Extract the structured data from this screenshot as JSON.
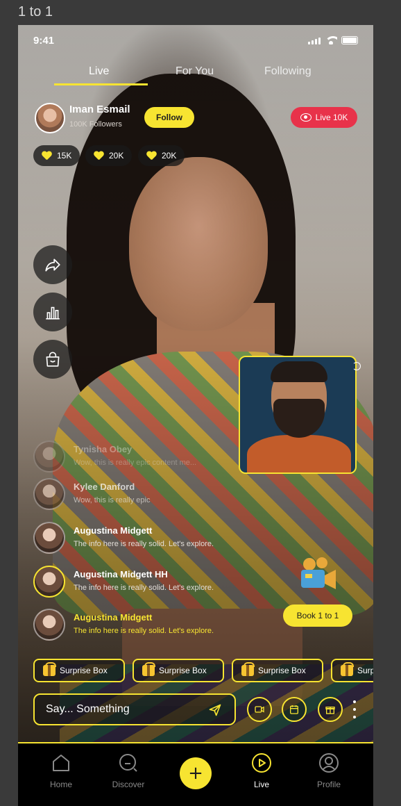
{
  "frame_label": "1 to 1",
  "status_bar": {
    "time": "9:41"
  },
  "tabs": [
    {
      "label": "Live",
      "active": true
    },
    {
      "label": "For You",
      "active": false
    },
    {
      "label": "Following",
      "active": false
    }
  ],
  "host": {
    "name": "Iman Esmail",
    "followers": "100K Followers",
    "follow_label": "Follow",
    "live_label": "Live 10K"
  },
  "stats": [
    "15K",
    "20K",
    "20K"
  ],
  "side_actions": [
    "share-icon",
    "leaderboard-icon",
    "shop-bag-icon"
  ],
  "comments": [
    {
      "name": "Tynisha Obey",
      "text": "Wow, this is really epic content me...",
      "style": "faded"
    },
    {
      "name": "Kylee Danford",
      "text": "Wow, this is really epic",
      "style": "mid"
    },
    {
      "name": "Augustina Midgett",
      "text": "The info here is really solid. Let's explore.",
      "style": "normal"
    },
    {
      "name": "Augustina Midgett HH",
      "text": "The info here is really solid. Let's explore.",
      "style": "highlight"
    },
    {
      "name": "Augustina Midgett",
      "text": "The info here is really solid. Let's explore.",
      "style": "yellow"
    }
  ],
  "book_label": "Book 1 to 1",
  "gifts": [
    "Surprise Box",
    "Surprise Box",
    "Surprise Box",
    "Surprise Box"
  ],
  "composer": {
    "placeholder": "Say... Something"
  },
  "composer_actions": [
    "video-call-icon",
    "calendar-icon",
    "gift-box-icon"
  ],
  "bottom_nav": [
    {
      "label": "Home",
      "icon": "home-icon",
      "active": false
    },
    {
      "label": "Discover",
      "icon": "discover-icon",
      "active": false
    },
    {
      "label": "",
      "icon": "plus-icon",
      "active": false
    },
    {
      "label": "Live",
      "icon": "live-icon",
      "active": true
    },
    {
      "label": "Profile",
      "icon": "profile-icon",
      "active": false
    }
  ],
  "colors": {
    "accent": "#f7e431",
    "live_red": "#e8324a",
    "nav_bg": "#000000"
  }
}
